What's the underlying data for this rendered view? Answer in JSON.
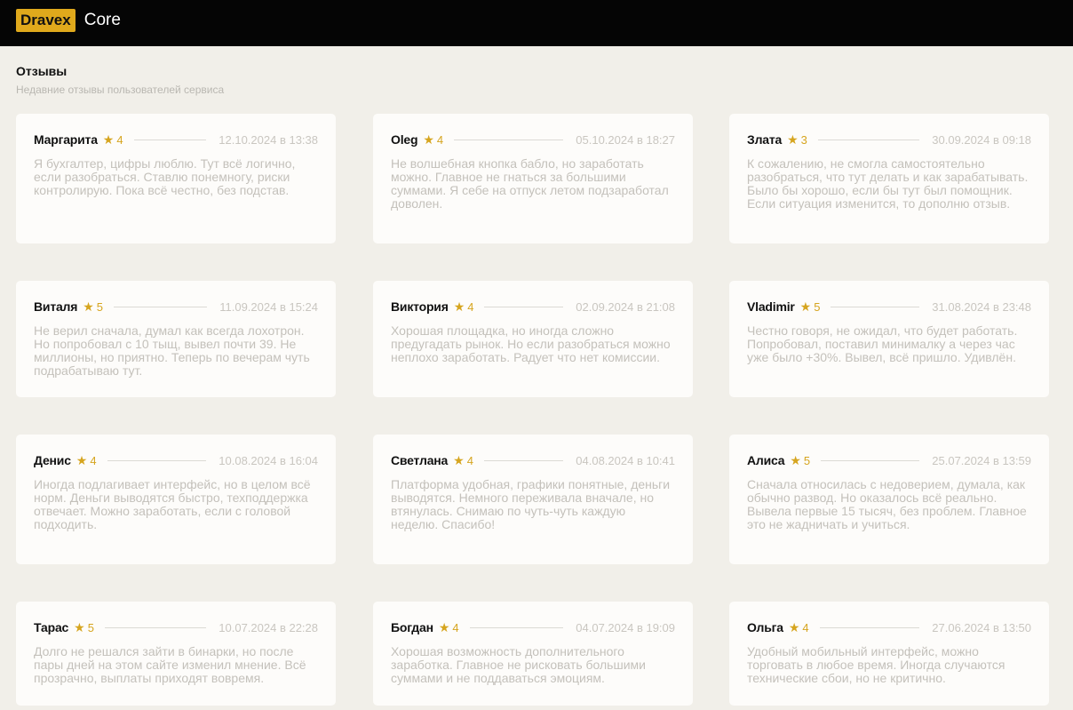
{
  "header": {
    "logo_badge": "Dravex",
    "logo_text": "Core"
  },
  "page": {
    "title": "Отзывы",
    "subtitle": "Недавние отзывы пользователей сервиса"
  },
  "colors": {
    "accent": "#e0a91c",
    "star": "#d6a51f",
    "topbar": "#050505",
    "background": "#f1efe9"
  },
  "reviews": [
    {
      "name": "Маргарита",
      "rating": "4",
      "date": "12.10.2024 в 13:38",
      "text": "Я бухгалтер, цифры люблю. Тут всё логично, если разобраться. Ставлю понемногу, риски контролирую. Пока всё честно, без подстав."
    },
    {
      "name": "Oleg",
      "rating": "4",
      "date": "05.10.2024 в 18:27",
      "text": "Не волшебная кнопка бабло, но заработать можно. Главное не гнаться за большими суммами. Я себе на отпуск летом подзаработал доволен."
    },
    {
      "name": "Злата",
      "rating": "3",
      "date": "30.09.2024 в 09:18",
      "text": "К сожалению, не смогла самостоятельно разобраться, что тут делать и как зарабатывать. Было бы хорошо, если бы тут был помощник. Если ситуация изменится, то дополню отзыв."
    },
    {
      "name": "Виталя",
      "rating": "5",
      "date": "11.09.2024 в 15:24",
      "text": "Не верил сначала, думал как всегда лохотрон. Но попробовал с 10 тыщ, вывел почти 39. Не миллионы, но приятно. Теперь по вечерам чуть подрабатываю тут."
    },
    {
      "name": "Виктория",
      "rating": "4",
      "date": "02.09.2024 в 21:08",
      "text": "Хорошая площадка, но иногда сложно предугадать рынок. Но если разобраться можно неплохо заработать. Радует что нет комиссии."
    },
    {
      "name": "Vladimir",
      "rating": "5",
      "date": "31.08.2024 в 23:48",
      "text": "Честно говоря, не ожидал, что будет работать. Попробовал, поставил минималку а через час уже было +30%. Вывел, всё пришло. Удивлён."
    },
    {
      "name": "Денис",
      "rating": "4",
      "date": "10.08.2024 в 16:04",
      "text": "Иногда подлагивает интерфейс, но в целом всё норм. Деньги выводятся быстро, техподдержка отвечает. Можно заработать, если с головой подходить."
    },
    {
      "name": "Светлана",
      "rating": "4",
      "date": "04.08.2024 в 10:41",
      "text": "Платформа удобная, графики понятные, деньги выводятся. Немного переживала вначале, но втянулась. Снимаю по чуть-чуть каждую неделю. Спасибо!"
    },
    {
      "name": "Алиса",
      "rating": "5",
      "date": "25.07.2024 в 13:59",
      "text": "Сначала относилась с недоверием, думала, как обычно развод. Но оказалось всё реально. Вывела первые 15 тысяч, без проблем. Главное это не жадничать и учиться."
    },
    {
      "name": "Тарас",
      "rating": "5",
      "date": "10.07.2024 в 22:28",
      "text": "Долго не решался зайти в бинарки, но после пары дней на этом сайте изменил мнение. Всё прозрачно, выплаты приходят вовремя."
    },
    {
      "name": "Богдан",
      "rating": "4",
      "date": "04.07.2024 в 19:09",
      "text": "Хорошая возможность дополнительного заработка. Главное не рисковать большими суммами и не поддаваться эмоциям."
    },
    {
      "name": "Ольга",
      "rating": "4",
      "date": "27.06.2024 в 13:50",
      "text": "Удобный мобильный интерфейс, можно торговать в любое время. Иногда случаются технические сбои, но не критично."
    }
  ]
}
